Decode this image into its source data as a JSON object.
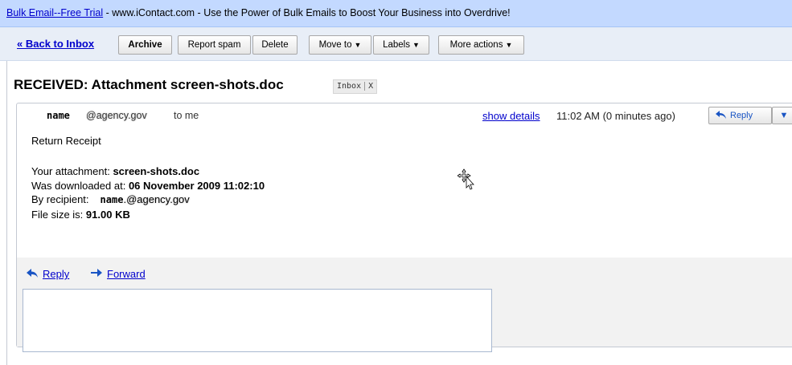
{
  "ad": {
    "title_link": "Bulk Email--Free Trial",
    "separator": " - ",
    "text": "www.iContact.com - Use the Power of Bulk Emails to Boost Your Business into Overdrive!"
  },
  "toolbar": {
    "back": "« Back to Inbox",
    "archive": "Archive",
    "report_spam": "Report spam",
    "delete": "Delete",
    "move_to": "Move to",
    "labels": "Labels",
    "more_actions": "More actions"
  },
  "subject": "RECEIVED: Attachment screen-shots.doc",
  "label": {
    "name": "Inbox",
    "remove": "X"
  },
  "message": {
    "sender_name": "name",
    "sender_domain": "@agency.gov",
    "to": "to me",
    "show_details": "show details",
    "time": "11:02 AM (0 minutes ago)",
    "reply_button": "Reply"
  },
  "receipt": {
    "heading": "Return Receipt",
    "attachment_label": "Your attachment:",
    "attachment_value": "screen-shots.doc",
    "downloaded_label": "Was downloaded at:",
    "downloaded_value": "06 November 2009 11:02:10",
    "recipient_label": "By recipient:",
    "recipient_name": "name",
    "recipient_domain": ".@agency.gov",
    "filesize_label": "File size is:",
    "filesize_value": "91.00 KB"
  },
  "actions": {
    "reply": "Reply",
    "forward": "Forward"
  },
  "colors": {
    "link": "#0000cc",
    "ad_bar": "#c3d9ff",
    "toolbar_bg": "#e8eef7",
    "reply_area": "#f2f2f2"
  },
  "icons": [
    "reply-arrow-icon",
    "forward-arrow-icon",
    "dropdown-arrow-icon",
    "move-cursor-icon"
  ]
}
